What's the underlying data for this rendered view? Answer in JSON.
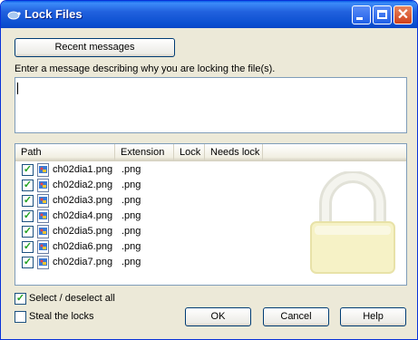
{
  "window": {
    "title": "Lock Files",
    "title_icon": "tortoise-icon",
    "controls": [
      "minimize",
      "maximize",
      "close"
    ]
  },
  "recent_messages_label": "Recent messages",
  "prompt": "Enter a message describing why you are locking the file(s).",
  "message_value": "",
  "columns": [
    "Path",
    "Extension",
    "Lock",
    "Needs lock"
  ],
  "files": [
    {
      "name": "ch02dia1.png",
      "ext": ".png",
      "checked": true
    },
    {
      "name": "ch02dia2.png",
      "ext": ".png",
      "checked": true
    },
    {
      "name": "ch02dia3.png",
      "ext": ".png",
      "checked": true
    },
    {
      "name": "ch02dia4.png",
      "ext": ".png",
      "checked": true
    },
    {
      "name": "ch02dia5.png",
      "ext": ".png",
      "checked": true
    },
    {
      "name": "ch02dia6.png",
      "ext": ".png",
      "checked": true
    },
    {
      "name": "ch02dia7.png",
      "ext": ".png",
      "checked": true
    }
  ],
  "select_all": {
    "label": "Select / deselect all",
    "checked": true
  },
  "steal_locks": {
    "label": "Steal the locks",
    "checked": false
  },
  "buttons": {
    "ok": "OK",
    "cancel": "Cancel",
    "help": "Help"
  },
  "colors": {
    "title_bar": "#0a5ee8",
    "dialog_bg": "#ece9d8",
    "check_green": "#21a121",
    "lock_yellow": "#f6f2c6"
  }
}
